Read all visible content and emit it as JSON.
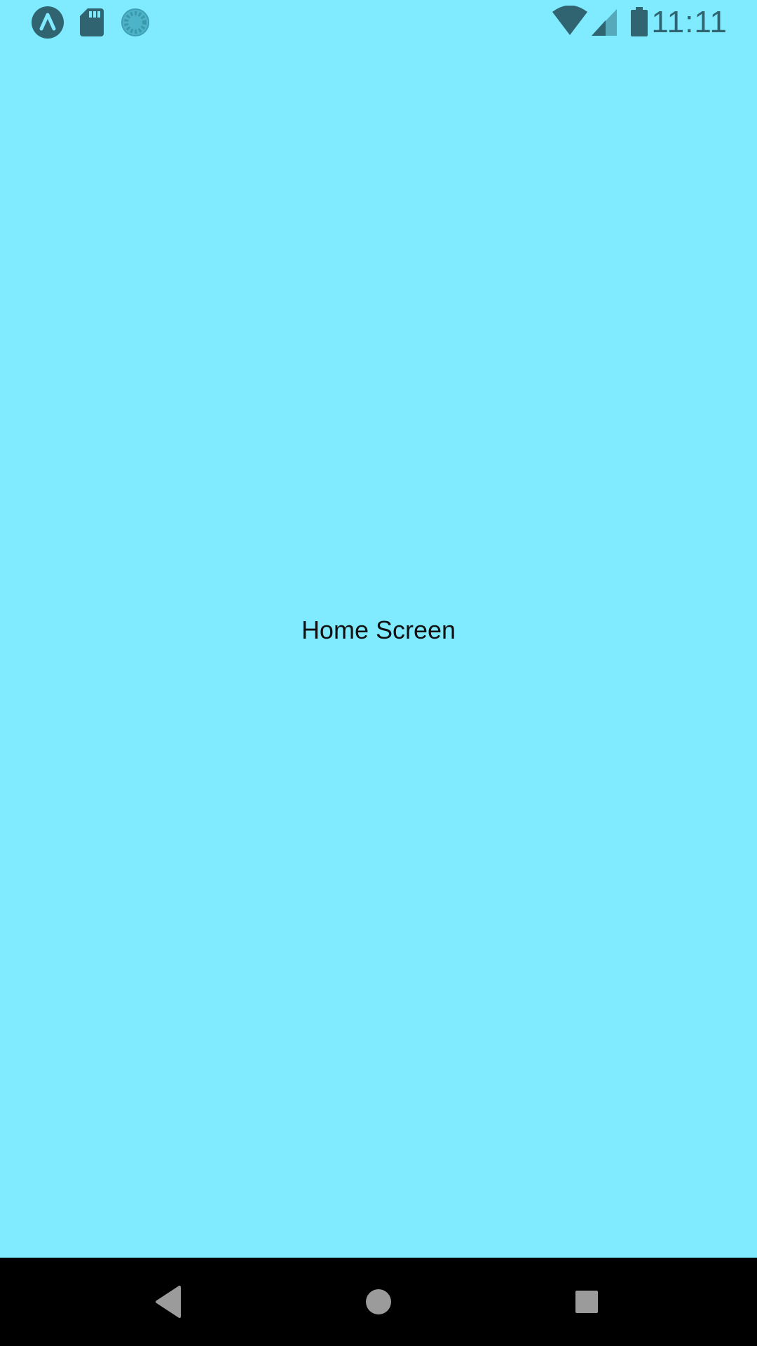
{
  "status_bar": {
    "time": "11:11",
    "notification_icons": [
      "app-a-icon",
      "sd-card-icon",
      "sync-icon"
    ],
    "system_icons": [
      "wifi-icon",
      "cellular-signal-icon",
      "battery-icon"
    ]
  },
  "main": {
    "title": "Home Screen",
    "background_color": "#80ebff"
  },
  "nav_bar": {
    "buttons": [
      "back-icon",
      "home-icon",
      "recents-icon"
    ]
  }
}
